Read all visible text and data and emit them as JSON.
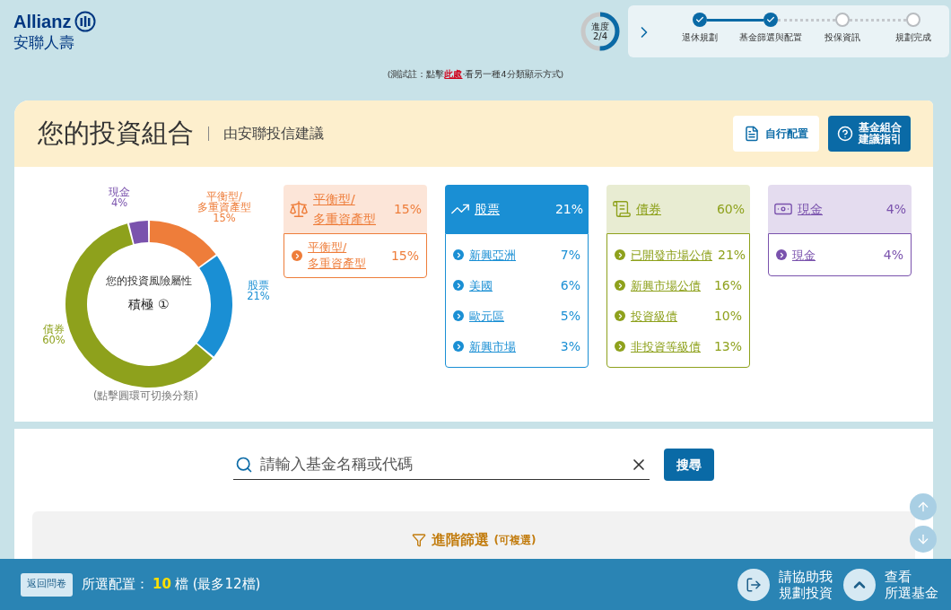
{
  "logo": {
    "brand": "Allianz",
    "subtitle": "安聯人壽"
  },
  "progress": {
    "label": "進度",
    "value": "2/4",
    "level": 0.5
  },
  "steps": [
    {
      "label": "退休規劃",
      "done": true
    },
    {
      "label": "基金篩選與配置",
      "done": true
    },
    {
      "label": "投保資訊",
      "done": false
    },
    {
      "label": "規劃完成",
      "done": false
    }
  ],
  "note": {
    "prefix": "(測試註：點擊",
    "link": "此處",
    "suffix": "‧看另一種4分類顯示方式)"
  },
  "portfolio": {
    "title": "您的投資組合",
    "subtitle": "由安聯投信建議",
    "buttons": [
      {
        "label": "自行配置",
        "primary": false
      },
      {
        "label": "基金組合建議指引",
        "primary": true
      }
    ],
    "risk_label": "您的投資風險屬性",
    "risk_value": "積極 ①",
    "chart_hint": "(點擊圓環可切換分類)",
    "chart_data": {
      "type": "donut",
      "categories": [
        "平衡型/多重資產型",
        "股票",
        "債券",
        "現金"
      ],
      "values": [
        15,
        21,
        60,
        4
      ],
      "value_labels": [
        "15%",
        "21%",
        "60%",
        "4%"
      ]
    },
    "categories": [
      {
        "name": [
          "平衡型/",
          "多重資產型"
        ],
        "pct": "15%",
        "color": "#ee7d3a",
        "selected": false,
        "items": [
          {
            "name": [
              "平衡型/",
              "多重資產型"
            ],
            "pct": "15%"
          }
        ]
      },
      {
        "name": "股票",
        "pct": "21%",
        "color": "#1a8fd4",
        "selected": true,
        "items": [
          {
            "name": "新興亞洲",
            "pct": "7%"
          },
          {
            "name": "美國",
            "pct": "6%"
          },
          {
            "name": "歐元區",
            "pct": "5%"
          },
          {
            "name": "新興市場",
            "pct": "3%"
          }
        ]
      },
      {
        "name": "債券",
        "pct": "60%",
        "color": "#8ea11c",
        "selected": false,
        "items": [
          {
            "name": "已開發市場公債",
            "pct": "21%"
          },
          {
            "name": "新興市場公債",
            "pct": "16%"
          },
          {
            "name": "投資級債",
            "pct": "10%"
          },
          {
            "name": "非投資等級債",
            "pct": "13%"
          }
        ]
      },
      {
        "name": "現金",
        "pct": "4%",
        "color": "#7a52ad",
        "selected": false,
        "items": [
          {
            "name": "現金",
            "pct": "4%"
          }
        ]
      }
    ]
  },
  "search": {
    "placeholder": "請輸入基金名稱或代碼",
    "button": "搜尋"
  },
  "filter": {
    "title": "進階篩選",
    "hint": "(可複選)"
  },
  "bottom_bar": {
    "back": "返回問卷",
    "selected_label": "所選配置：",
    "count": "10",
    "count_suffix": "檔 (最多12檔)",
    "help": "請協助我規劃投資",
    "view": [
      "查看",
      "所選基金"
    ]
  }
}
